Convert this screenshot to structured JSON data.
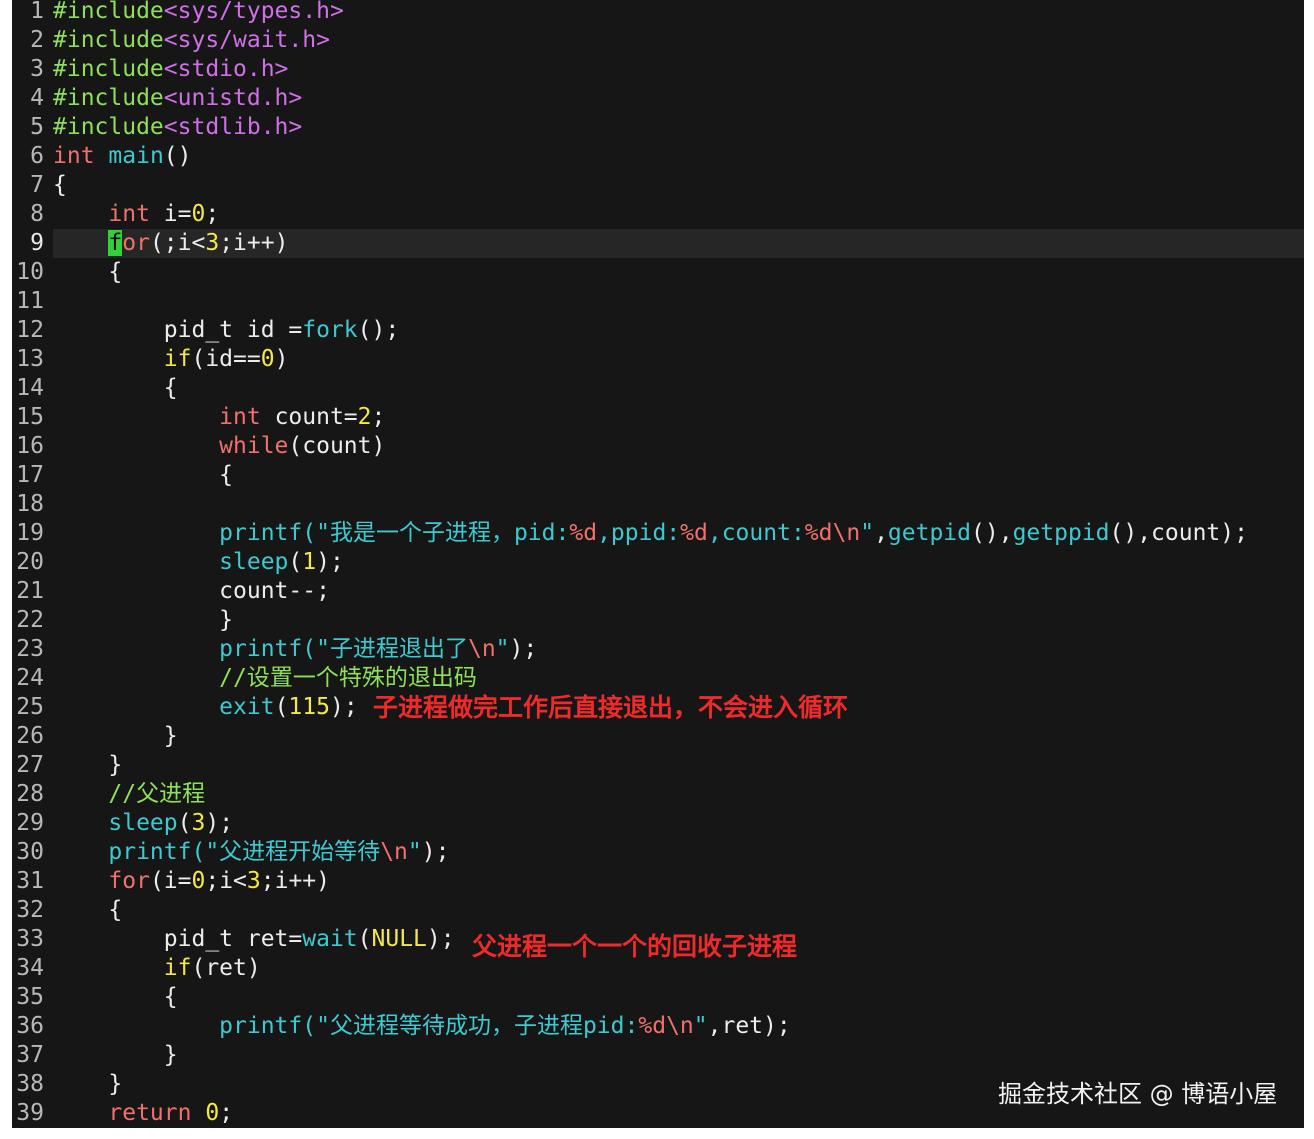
{
  "editor": {
    "cursor_line": 9,
    "lines": [
      [
        [
          "#include",
          "pp"
        ],
        [
          "<sys/types.h>",
          "inc"
        ]
      ],
      [
        [
          "#include",
          "pp"
        ],
        [
          "<sys/wait.h>",
          "inc"
        ]
      ],
      [
        [
          "#include",
          "pp"
        ],
        [
          "<stdio.h>",
          "inc"
        ]
      ],
      [
        [
          "#include",
          "pp"
        ],
        [
          "<unistd.h>",
          "inc"
        ]
      ],
      [
        [
          "#include",
          "pp"
        ],
        [
          "<stdlib.h>",
          "inc"
        ]
      ],
      [
        [
          "int",
          "kw"
        ],
        [
          " "
        ],
        [
          "main",
          "fn"
        ],
        [
          "()"
        ]
      ],
      [
        [
          "{"
        ]
      ],
      [
        [
          "    "
        ],
        [
          "int",
          "kw"
        ],
        [
          " i="
        ],
        [
          "0",
          "num"
        ],
        [
          ";"
        ]
      ],
      [
        [
          "    "
        ],
        [
          "f",
          "kw cursor"
        ],
        [
          "or",
          "kw"
        ],
        [
          "(;i<"
        ],
        [
          "3",
          "num"
        ],
        [
          ";i++)"
        ]
      ],
      [
        [
          "    {"
        ]
      ],
      [
        [
          ""
        ]
      ],
      [
        [
          "        pid_t id ="
        ],
        [
          "fork",
          "fn"
        ],
        [
          "();"
        ]
      ],
      [
        [
          "        "
        ],
        [
          "if",
          "num"
        ],
        [
          "(id=="
        ],
        [
          "0",
          "num"
        ],
        [
          ")"
        ]
      ],
      [
        [
          "        {"
        ]
      ],
      [
        [
          "            "
        ],
        [
          "int",
          "kw"
        ],
        [
          " count="
        ],
        [
          "2",
          "num"
        ],
        [
          ";"
        ]
      ],
      [
        [
          "            "
        ],
        [
          "while",
          "kw"
        ],
        [
          "(count)"
        ]
      ],
      [
        [
          "            {"
        ]
      ],
      [
        [
          ""
        ]
      ],
      [
        [
          "            "
        ],
        [
          "printf",
          "fn"
        ],
        [
          "(\"我是一个子进程，pid:",
          "str"
        ],
        [
          "%d",
          "fmt"
        ],
        [
          ",ppid:",
          "str"
        ],
        [
          "%d",
          "fmt"
        ],
        [
          ",count:",
          "str"
        ],
        [
          "%d",
          "fmt"
        ],
        [
          "\\n",
          "fmt"
        ],
        [
          "\"",
          "str"
        ],
        [
          ","
        ],
        [
          "getpid",
          "fn"
        ],
        [
          "(),"
        ],
        [
          "getppid",
          "fn"
        ],
        [
          "(),count);"
        ]
      ],
      [
        [
          "            "
        ],
        [
          "sleep",
          "fn"
        ],
        [
          "("
        ],
        [
          "1",
          "num"
        ],
        [
          ");"
        ]
      ],
      [
        [
          "            count--;"
        ]
      ],
      [
        [
          "            }"
        ]
      ],
      [
        [
          "            "
        ],
        [
          "printf",
          "fn"
        ],
        [
          "(\"子进程退出了",
          "str"
        ],
        [
          "\\n",
          "fmt"
        ],
        [
          "\"",
          "str"
        ],
        [
          ");"
        ]
      ],
      [
        [
          "            "
        ],
        [
          "//设置一个特殊的退出码",
          "cm"
        ]
      ],
      [
        [
          "            "
        ],
        [
          "exit",
          "fn"
        ],
        [
          "("
        ],
        [
          "115",
          "num"
        ],
        [
          ");"
        ]
      ],
      [
        [
          "        }"
        ]
      ],
      [
        [
          "    }"
        ]
      ],
      [
        [
          "    "
        ],
        [
          "//父进程",
          "cm"
        ]
      ],
      [
        [
          "    "
        ],
        [
          "sleep",
          "fn"
        ],
        [
          "("
        ],
        [
          "3",
          "num"
        ],
        [
          ");"
        ]
      ],
      [
        [
          "    "
        ],
        [
          "printf",
          "fn"
        ],
        [
          "(\"父进程开始等待",
          "str"
        ],
        [
          "\\n",
          "fmt"
        ],
        [
          "\"",
          "str"
        ],
        [
          ");"
        ]
      ],
      [
        [
          "    "
        ],
        [
          "for",
          "kw"
        ],
        [
          "(i="
        ],
        [
          "0",
          "num"
        ],
        [
          ";i<"
        ],
        [
          "3",
          "num"
        ],
        [
          ";i++)"
        ]
      ],
      [
        [
          "    {"
        ]
      ],
      [
        [
          "        pid_t ret="
        ],
        [
          "wait",
          "fn"
        ],
        [
          "("
        ],
        [
          "NULL",
          "num"
        ],
        [
          ");"
        ]
      ],
      [
        [
          "        "
        ],
        [
          "if",
          "num"
        ],
        [
          "(ret)"
        ]
      ],
      [
        [
          "        {"
        ]
      ],
      [
        [
          "            "
        ],
        [
          "printf",
          "fn"
        ],
        [
          "(\"父进程等待成功，子进程pid:",
          "str"
        ],
        [
          "%d",
          "fmt"
        ],
        [
          "\\n",
          "fmt"
        ],
        [
          "\"",
          "str"
        ],
        [
          ",ret);"
        ]
      ],
      [
        [
          "        }"
        ]
      ],
      [
        [
          "    }"
        ]
      ],
      [
        [
          "    "
        ],
        [
          "return",
          "kw"
        ],
        [
          " "
        ],
        [
          "0",
          "num"
        ],
        [
          ";"
        ]
      ]
    ]
  },
  "annotations": {
    "child_exit": "子进程做完工作后直接退出，不会进入循环",
    "parent_wait": "父进程一个一个的回收子进程"
  },
  "watermark": "掘金技术社区 @ 博语小屋",
  "colors": {
    "background": "#161616",
    "keyword": "#f0706c",
    "function": "#3ec9d0",
    "number": "#f3e84a",
    "comment": "#8ee05a",
    "annotation": "#ee2a2a"
  }
}
